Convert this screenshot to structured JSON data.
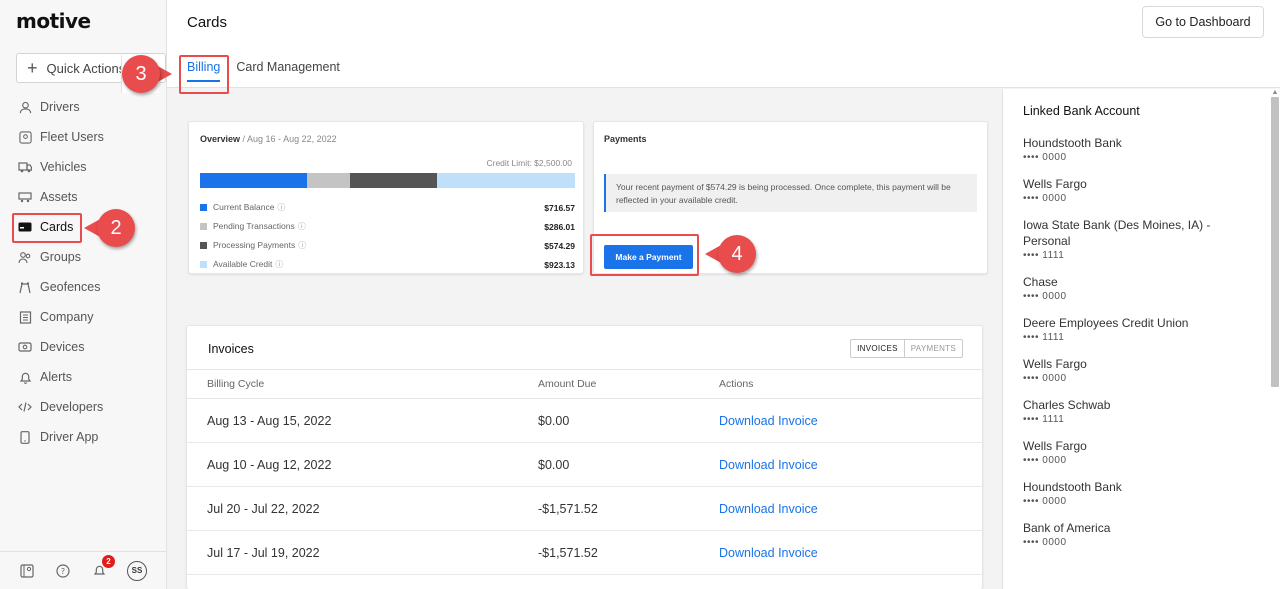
{
  "app": {
    "logo": "motive"
  },
  "sidebar": {
    "quick_action": "Quick Actions",
    "items": [
      {
        "label": "Drivers",
        "icon": "person-icon"
      },
      {
        "label": "Fleet Users",
        "icon": "user-square-icon"
      },
      {
        "label": "Vehicles",
        "icon": "truck-icon"
      },
      {
        "label": "Assets",
        "icon": "trailer-icon"
      },
      {
        "label": "Cards",
        "icon": "card-icon"
      },
      {
        "label": "Groups",
        "icon": "group-icon"
      },
      {
        "label": "Geofences",
        "icon": "geofence-icon"
      },
      {
        "label": "Company",
        "icon": "building-icon"
      },
      {
        "label": "Devices",
        "icon": "device-icon"
      },
      {
        "label": "Alerts",
        "icon": "bell-icon"
      },
      {
        "label": "Developers",
        "icon": "code-icon"
      },
      {
        "label": "Driver App",
        "icon": "phone-icon"
      }
    ],
    "footer": {
      "notification_count": "2",
      "avatar_initials": "SS"
    }
  },
  "header": {
    "title": "Cards",
    "dashboard_button": "Go to Dashboard",
    "tabs": [
      {
        "label": "Billing",
        "active": true
      },
      {
        "label": "Card Management",
        "active": false
      }
    ]
  },
  "overview": {
    "title": "Overview",
    "range": " / Aug 16 - Aug 22, 2022",
    "credit_limit": "Credit Limit: $2,500.00",
    "bar": [
      {
        "color": "#1a73e8",
        "value": 716.57
      },
      {
        "color": "#c4c4c4",
        "value": 286.01
      },
      {
        "color": "#555555",
        "value": 574.29
      },
      {
        "color": "#bfe0fb",
        "value": 923.13
      }
    ],
    "legend": [
      {
        "label": "Current Balance",
        "amount": "$716.57",
        "color": "#1a73e8"
      },
      {
        "label": "Pending Transactions",
        "amount": "$286.01",
        "color": "#c4c4c4"
      },
      {
        "label": "Processing Payments",
        "amount": "$574.29",
        "color": "#555555"
      },
      {
        "label": "Available Credit",
        "amount": "$923.13",
        "color": "#bfe0fb"
      }
    ]
  },
  "payments": {
    "title": "Payments",
    "note": "Your recent payment of $574.29 is being processed. Once complete, this payment will be reflected in your available credit.",
    "button": "Make a Payment"
  },
  "invoices": {
    "title": "Invoices",
    "toggle": [
      "INVOICES",
      "PAYMENTS"
    ],
    "columns": [
      "Billing Cycle",
      "Amount Due",
      "Actions"
    ],
    "rows": [
      {
        "cycle": "Aug 13 - Aug 15, 2022",
        "amount": "$0.00",
        "action": "Download Invoice"
      },
      {
        "cycle": "Aug 10 - Aug 12, 2022",
        "amount": "$0.00",
        "action": "Download Invoice"
      },
      {
        "cycle": "Jul 20 - Jul 22, 2022",
        "amount": "-$1,571.52",
        "action": "Download Invoice"
      },
      {
        "cycle": "Jul 17 - Jul 19, 2022",
        "amount": "-$1,571.52",
        "action": "Download Invoice"
      }
    ]
  },
  "linked_bank": {
    "title": "Linked Bank Account",
    "accounts": [
      {
        "name": "Houndstooth Bank",
        "acct": "•••• 0000"
      },
      {
        "name": "Wells Fargo",
        "acct": "•••• 0000"
      },
      {
        "name": "Iowa State Bank (Des Moines, IA) - Personal",
        "acct": "•••• 1111"
      },
      {
        "name": "Chase",
        "acct": "•••• 0000"
      },
      {
        "name": "Deere Employees Credit Union",
        "acct": "•••• 1111"
      },
      {
        "name": "Wells Fargo",
        "acct": "•••• 0000"
      },
      {
        "name": "Charles Schwab",
        "acct": "•••• 1111"
      },
      {
        "name": "Wells Fargo",
        "acct": "•••• 0000"
      },
      {
        "name": "Houndstooth Bank",
        "acct": "•••• 0000"
      },
      {
        "name": "Bank of America",
        "acct": "•••• 0000"
      }
    ]
  },
  "annotations": {
    "step2": "2",
    "step3": "3",
    "step4": "4"
  },
  "colors": {
    "accent": "#1a73e8",
    "annotation": "#e84c4c"
  }
}
